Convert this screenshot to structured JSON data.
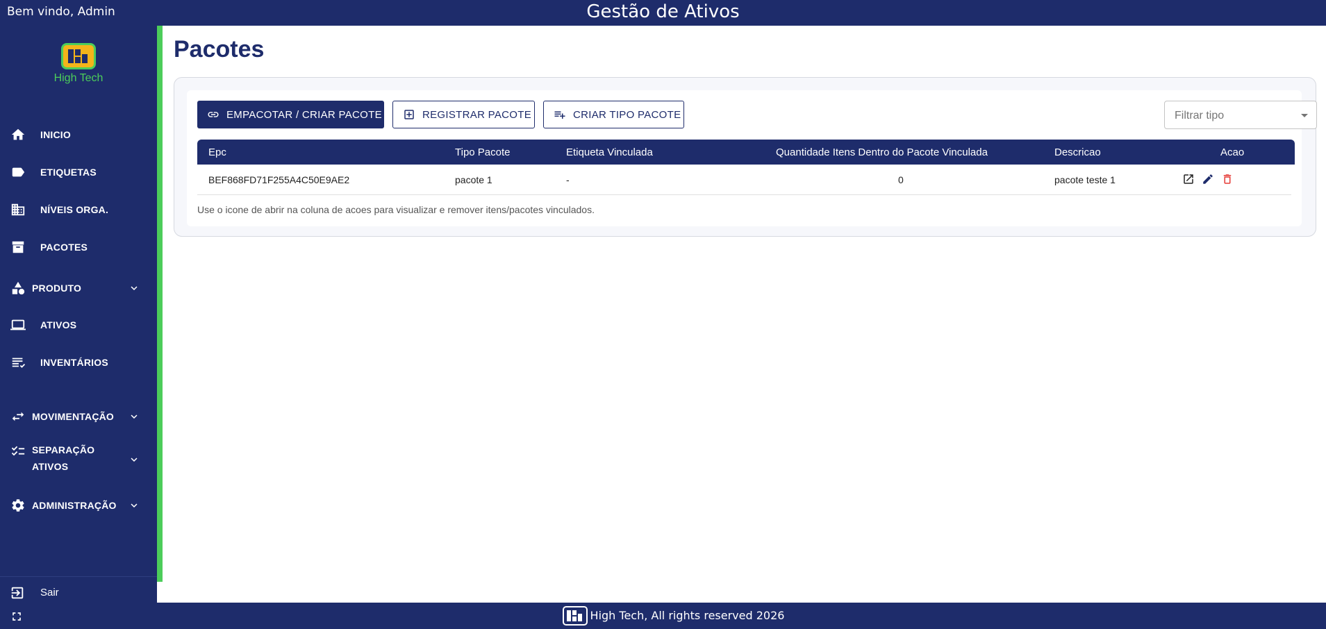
{
  "header": {
    "welcome": "Bem vindo, Admin",
    "title": "Gestão de Ativos"
  },
  "brand": {
    "name": "High Tech"
  },
  "sidebar": {
    "items": [
      {
        "label": "INICIO",
        "icon": "home-icon"
      },
      {
        "label": "ETIQUETAS",
        "icon": "label-icon"
      },
      {
        "label": "NÍVEIS ORGA.",
        "icon": "building-icon"
      },
      {
        "label": "PACOTES",
        "icon": "archive-icon"
      },
      {
        "label": "PRODUTO",
        "icon": "category-icon",
        "expandable": true
      },
      {
        "label": "ATIVOS",
        "icon": "laptop-icon"
      },
      {
        "label": "INVENTÁRIOS",
        "icon": "list-icon"
      },
      {
        "label": "MOVIMENTAÇÃO",
        "icon": "swap-icon",
        "expandable": true
      },
      {
        "label_line1": "SEPARAÇÃO",
        "label_line2": "ATIVOS",
        "icon": "checklist-icon",
        "expandable": true
      },
      {
        "label": "ADMINISTRAÇÃO",
        "icon": "gear-icon",
        "expandable": true
      }
    ],
    "logout": "Sair"
  },
  "main": {
    "title": "Pacotes",
    "buttons": {
      "pack": "EMPACOTAR / CRIAR PACOTE",
      "register": "REGISTRAR PACOTE",
      "create_type": "CRIAR TIPO PACOTE"
    },
    "filter": {
      "placeholder": "Filtrar tipo"
    },
    "table": {
      "columns": [
        "Epc",
        "Tipo Pacote",
        "Etiqueta Vinculada",
        "Quantidade Itens Dentro do Pacote Vinculada",
        "Descricao",
        "Acao"
      ],
      "rows": [
        {
          "epc": "BEF868FD71F255A4C50E9AE2",
          "tipo": "pacote 1",
          "etiqueta": "-",
          "quantidade": "0",
          "descricao": "pacote teste 1"
        }
      ]
    },
    "note": "Use o icone de abrir na coluna de acoes para visualizar e remover itens/pacotes vinculados."
  },
  "footer": {
    "copyright": "High Tech, All rights reserved 2026"
  },
  "colors": {
    "primary": "#1e2c6b",
    "accent": "#4ccd5a",
    "logo_fill": "#f4b41a",
    "delete": "#e53935"
  }
}
